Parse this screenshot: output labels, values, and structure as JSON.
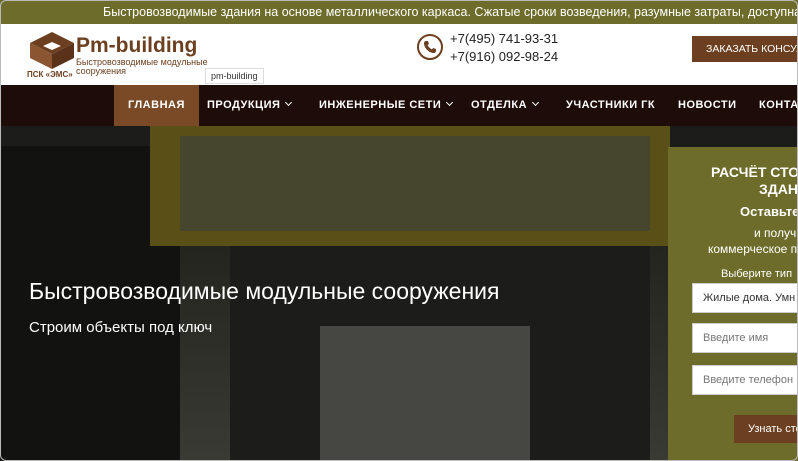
{
  "ticker": {
    "text": "Быстровозводимые здания на основе металлического каркаса. Сжатые сроки возведения, разумные затраты, доступная сто"
  },
  "header": {
    "brand": "Pm-building",
    "tagline": "Быстровозводимые модульные сооружения",
    "company": "ПСК «ЭМС»",
    "tooltip": "pm-building",
    "phones": [
      "+7(495) 741-93-31",
      "+7(916) 092-98-24"
    ],
    "order_button": "ЗАКАЗАТЬ КОНСУЛЬ"
  },
  "nav": {
    "items": [
      {
        "label": "ГЛАВНАЯ",
        "active": true
      },
      {
        "label": "ПРОДУКЦИЯ",
        "dropdown": true
      },
      {
        "label": "ИНЖЕНЕРНЫЕ СЕТИ",
        "dropdown": true
      },
      {
        "label": "ОТДЕЛКА",
        "dropdown": true
      },
      {
        "label": "УЧАСТНИКИ ГК"
      },
      {
        "label": "НОВОСТИ"
      },
      {
        "label": "КОНТАК"
      }
    ]
  },
  "hero": {
    "title": "Быстровозводимые модульные сооружения",
    "subtitle": "Строим объекты под ключ"
  },
  "calc": {
    "title_line1": "РАСЧЁТ СТО",
    "title_line2": "ЗДАН",
    "leave": "Оставьте",
    "get": "и получите",
    "offer": "коммерческое п",
    "choose": "Выберите тип",
    "select_value": "Жилые дома. Умн",
    "name_placeholder": "Введите имя",
    "phone_placeholder": "Введите телефон",
    "button": "Узнать сто"
  },
  "colors": {
    "olive": "#6e6c2a",
    "brown": "#6b3f1f",
    "nav_bg": "#1d0c07",
    "nav_active": "#7a4a26"
  },
  "icons": {
    "logo": "cube-logo-icon",
    "phone": "phone-icon",
    "dropdown": "chevron-down-icon"
  }
}
